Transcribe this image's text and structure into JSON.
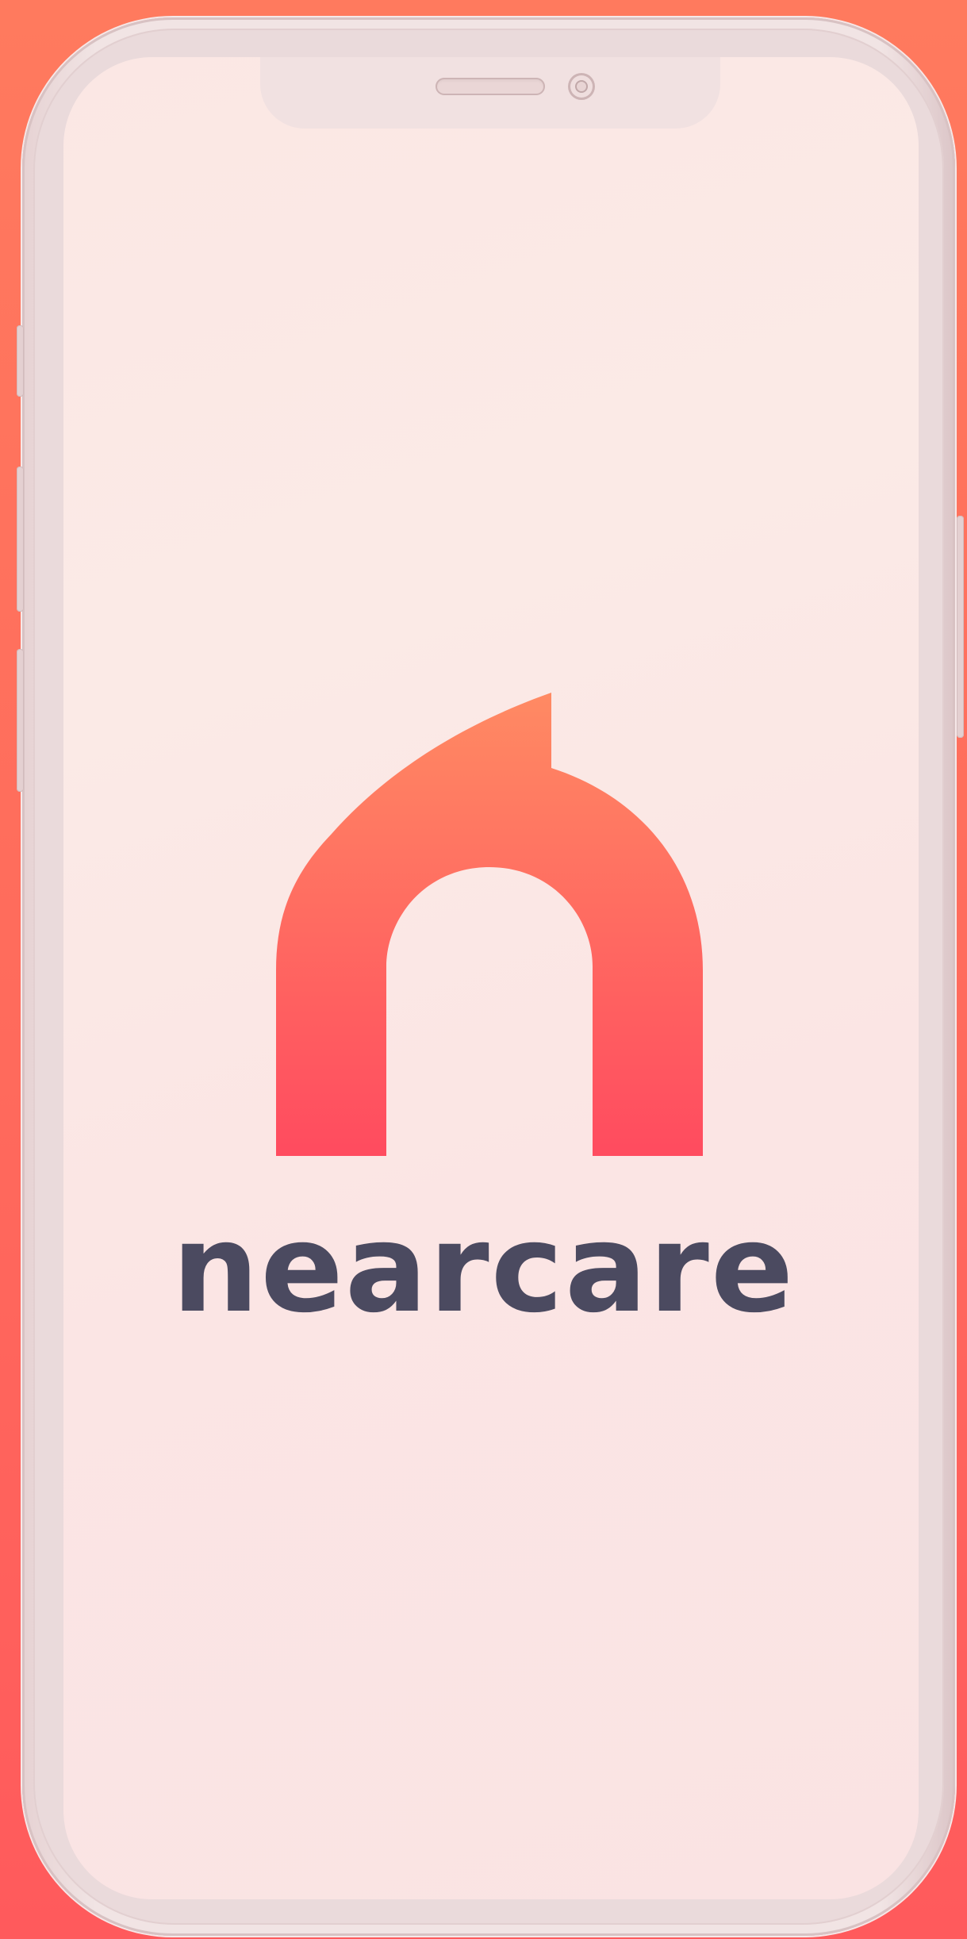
{
  "app": {
    "brand_name": "nearcare"
  },
  "device": {
    "model": "iPhone",
    "frame_color": "#f1e4e4",
    "screen_color": "#fbe7e4"
  },
  "brand_colors": {
    "background_top": "#ff7a5e",
    "background_bottom": "#ff5a5c",
    "logo_gradient_top": "#ff8a63",
    "logo_gradient_bottom": "#ff4b5f",
    "wordmark": "#4b4a60"
  },
  "icons": {
    "logo": "nearcare-house-n-icon"
  }
}
